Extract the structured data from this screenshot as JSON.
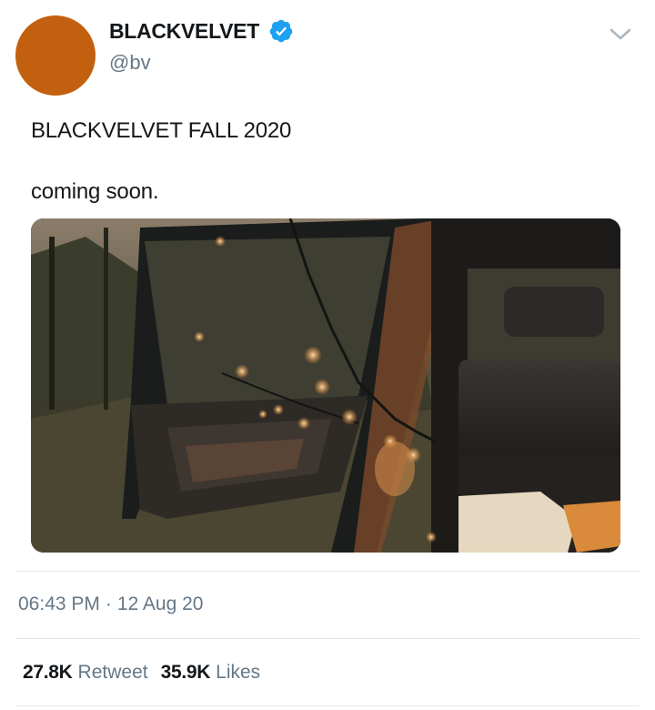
{
  "author": {
    "display_name": "BLACKVELVET",
    "handle": "@bv",
    "avatar_color": "#c2600f",
    "verified": true
  },
  "icons": {
    "verified": "verified-badge-icon",
    "menu": "chevron-down-icon"
  },
  "tweet": {
    "lines": [
      "BLACKVELVET FALL 2020",
      "coming soon."
    ]
  },
  "media": {
    "kind": "photo"
  },
  "meta": {
    "time": "06:43 PM",
    "separator": "·",
    "date": "12 Aug 20"
  },
  "stats": {
    "retweets_count": "27.8K",
    "retweets_label": "Retweet",
    "likes_count": "35.9K",
    "likes_label": "Likes"
  },
  "colors": {
    "verified_blue": "#1da1f2",
    "secondary_text": "#657786",
    "divider": "#e1e8ed"
  }
}
